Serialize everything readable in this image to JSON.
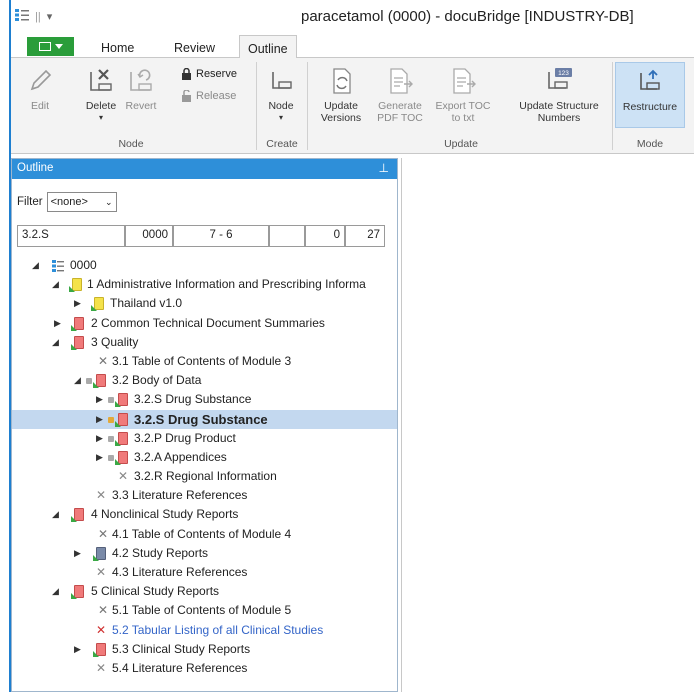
{
  "titlebar": {
    "title": "paracetamol (0000) - docuBridge [INDUSTRY-DB]"
  },
  "tabs": [
    {
      "label": "Home"
    },
    {
      "label": "Review"
    },
    {
      "label": "Outline"
    }
  ],
  "ribbon": {
    "node_group": {
      "edit": "Edit",
      "delete": "Delete",
      "revert": "Revert",
      "reserve": "Reserve",
      "release": "Release",
      "label": "Node"
    },
    "create_group": {
      "node": "Node",
      "label": "Create"
    },
    "update_group": {
      "update_versions": "Update Versions",
      "generate_pdf_toc": "Generate PDF TOC",
      "export_toc": "Export TOC to txt",
      "update_structure_numbers": "Update Structure Numbers",
      "label": "Update"
    },
    "mode_group": {
      "restructure": "Restructure",
      "label": "Mode"
    },
    "badge_number": "123"
  },
  "outline": {
    "header": "Outline",
    "filter_label": "Filter",
    "filter_value": "<none>",
    "fields": [
      "3.2.S",
      "0000",
      "7 - 6",
      "",
      "0",
      "27"
    ],
    "tree": [
      {
        "label": "0000"
      },
      {
        "label": "1 Administrative Information and Prescribing Informa"
      },
      {
        "label": "Thailand v1.0"
      },
      {
        "label": "2 Common Technical Document Summaries"
      },
      {
        "label": "3 Quality"
      },
      {
        "label": "3.1 Table of Contents of Module 3"
      },
      {
        "label": "3.2 Body of Data"
      },
      {
        "label": "3.2.S Drug Substance"
      },
      {
        "label": "3.2.S Drug Substance"
      },
      {
        "label": "3.2.P Drug Product"
      },
      {
        "label": "3.2.A Appendices"
      },
      {
        "label": "3.2.R Regional Information"
      },
      {
        "label": "3.3 Literature References"
      },
      {
        "label": "4 Nonclinical Study Reports"
      },
      {
        "label": "4.1 Table of Contents of Module 4"
      },
      {
        "label": "4.2 Study Reports"
      },
      {
        "label": "4.3 Literature References"
      },
      {
        "label": "5 Clinical Study Reports"
      },
      {
        "label": "5.1 Table of Contents of Module 5"
      },
      {
        "label": "5.2 Tabular Listing of all Clinical Studies"
      },
      {
        "label": "5.3 Clinical Study Reports"
      },
      {
        "label": "5.4 Literature References"
      }
    ]
  }
}
